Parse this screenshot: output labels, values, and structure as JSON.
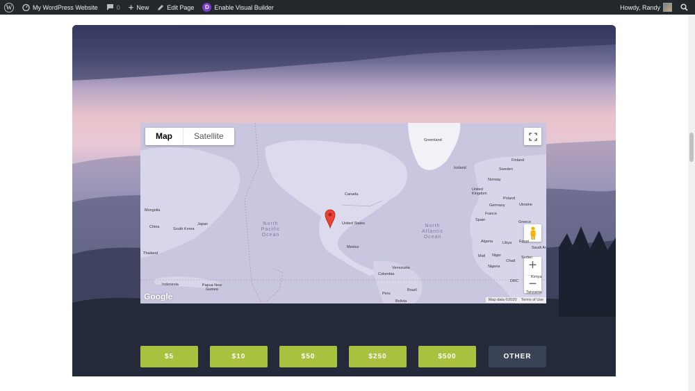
{
  "adminbar": {
    "site_name": "My WordPress Website",
    "comment_count": "0",
    "new_label": "New",
    "edit_label": "Edit Page",
    "builder_label": "Enable Visual Builder",
    "builder_letter": "D",
    "greeting": "Howdy, Randy"
  },
  "map": {
    "type_map": "Map",
    "type_satellite": "Satellite",
    "labels": {
      "greenland": "Greenland",
      "finland": "Finland",
      "iceland": "Iceland",
      "sweden": "Sweden",
      "norway": "Norway",
      "united_kingdom": "United Kingdom",
      "germany": "Germany",
      "poland": "Poland",
      "ukraine": "Ukraine",
      "france": "France",
      "spain": "Spain",
      "greece": "Greece",
      "canada": "Canada",
      "united_states": "United States",
      "mexico": "Mexico",
      "venezuela": "Venezuela",
      "colombia": "Colombia",
      "peru": "Peru",
      "brazil": "Brazil",
      "bolivia": "Bolivia",
      "mongolia": "Mongolia",
      "china": "China",
      "south_korea": "South Korea",
      "japan": "Japan",
      "thailand": "Thailand",
      "indonesia": "Indonesia",
      "papua": "Papua New Guinea",
      "algeria": "Algeria",
      "libya": "Libya",
      "egypt": "Egypt",
      "saudi": "Saudi Ar",
      "mali": "Mali",
      "niger": "Niger",
      "chad": "Chad",
      "sudan": "Sudan",
      "nigeria": "Nigeria",
      "drc": "DRC",
      "kenya": "Kenya",
      "tanzania": "Tanzania"
    },
    "ocean_pacific": "North Pacific Ocean",
    "ocean_atlantic": "North Atlantic Ocean",
    "google": "Google",
    "attribution": "Map data ©2020",
    "terms": "Terms of Use"
  },
  "donate_buttons": [
    "$5",
    "$10",
    "$50",
    "$250",
    "$500",
    "OTHER"
  ],
  "colors": {
    "button_green": "#a8c23f",
    "button_dark": "#3a4356",
    "admin_bar": "#23282d"
  }
}
